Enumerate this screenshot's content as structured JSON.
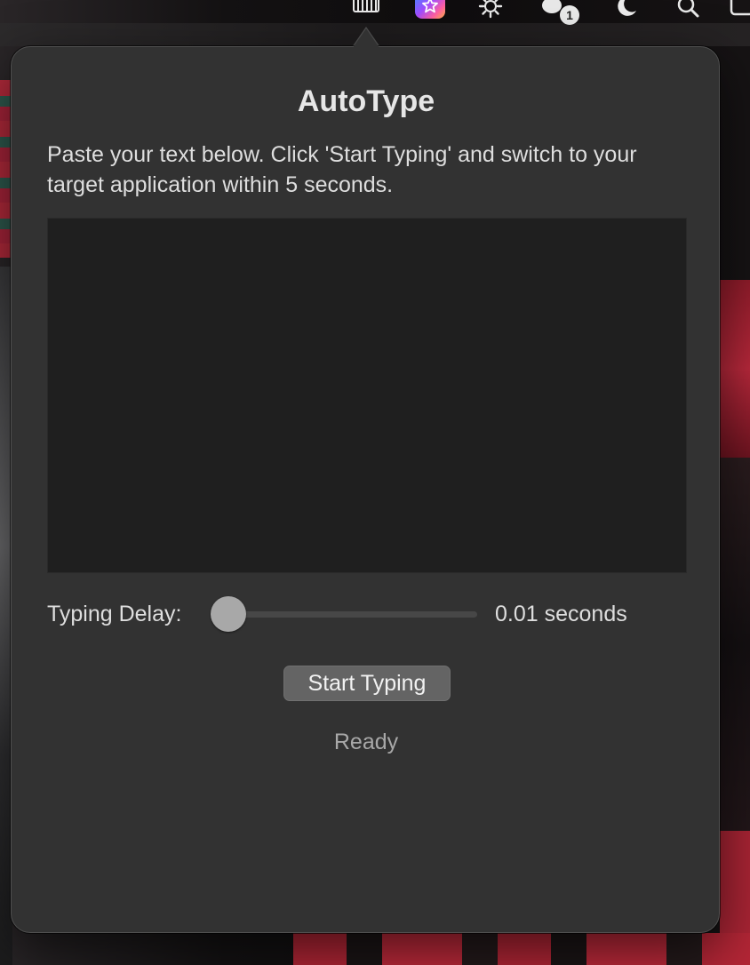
{
  "menubar": {
    "icons": [
      "keyboard-icon",
      "app-star-icon",
      "gear-icon",
      "chat-icon",
      "moon-icon",
      "search-icon",
      "control-center-icon"
    ],
    "chat_badge": "1"
  },
  "popover": {
    "title": "AutoType",
    "instructions": "Paste your text below. Click 'Start Typing' and switch to your target application within 5 seconds.",
    "text_input": "",
    "delay": {
      "label": "Typing Delay:",
      "value_text": "0.01 seconds",
      "value": 0.01
    },
    "start_button": "Start Typing",
    "status": "Ready"
  }
}
